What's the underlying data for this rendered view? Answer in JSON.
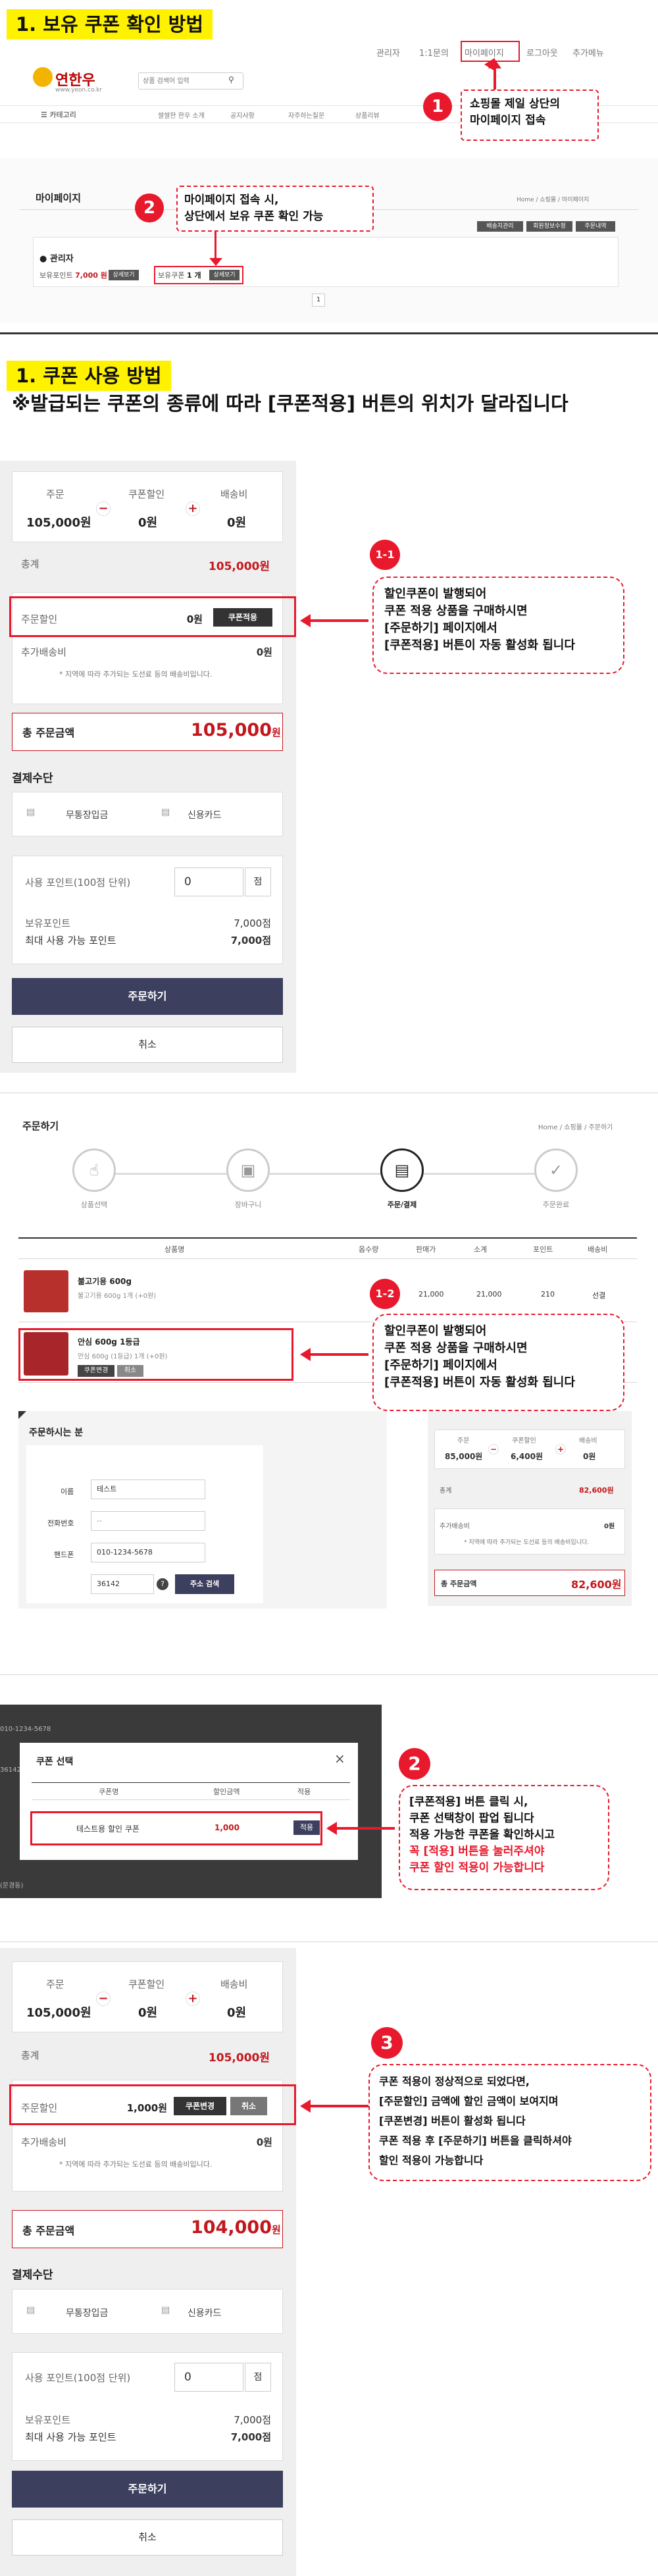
{
  "sec1": {
    "title": "1. 보유 쿠폰 확인 방법"
  },
  "topnav": [
    "관리자",
    "1:1문의",
    "마이페이지",
    "로그아웃",
    "추가메뉴"
  ],
  "logo": {
    "text": "연한우",
    "domain": "www.yeon.co.kr"
  },
  "search": {
    "placeholder": "상품 검색어 입력"
  },
  "menu": {
    "category": "카테고리",
    "items": [
      "쌀쌀한 한우 소개",
      "공지사항",
      "자주하는질문",
      "상품리뷰"
    ]
  },
  "ann1": {
    "num": "1",
    "text": "쇼핑몰 제일 상단의\n마이페이지 접속"
  },
  "mypage": {
    "title": "마이페이지",
    "breadcrumb": "Home / 쇼핑몰 / 마이페이지",
    "tabs": [
      "배송지관리",
      "회원정보수정",
      "주문내역"
    ],
    "user": "관리자",
    "points_label": "보유포인트",
    "points": "7,000 원",
    "points_btn": "상세보기",
    "coupon_label": "보유쿠폰",
    "coupon_count": "1 개",
    "coupon_btn": "상세보기",
    "page": "1"
  },
  "ann2a": {
    "num": "2",
    "text": "마이페이지 접속 시,\n상단에서 보유 쿠폰 확인 가능"
  },
  "sec2": {
    "title": "1. 쿠폰 사용 방법",
    "subtitle": "※발급되는 쿠폰의 종류에 따라 [쿠폰적용] 버튼의 위치가 달라집니다"
  },
  "order1": {
    "h1": "주문",
    "h2": "쿠폰할인",
    "h3": "배송비",
    "v1": "105,000원",
    "v2": "0원",
    "v3": "0원",
    "total_label": "총계",
    "total": "105,000원",
    "coupon_label": "주문할인",
    "coupon_val": "0원",
    "coupon_btn": "쿠폰적용",
    "extra_label": "추가배송비",
    "extra_val": "0원",
    "note": "* 지역에 따라 추가되는 도선료 등의 배송비입니다.",
    "sum_label": "총 주문금액",
    "sum_val": "105,000",
    "sum_unit": "원",
    "pay_title": "결제수단",
    "pay1": "무통장입금",
    "pay2": "신용카드",
    "point_label": "사용 포인트(100점 단위)",
    "point_val": "0",
    "point_unit": "점",
    "have_label": "보유포인트",
    "have_val": "7,000점",
    "max_label": "최대 사용 가능 포인트",
    "max_val": "7,000점",
    "order_btn": "주문하기",
    "cancel_btn": "취소"
  },
  "ann11": {
    "num": "1-1",
    "text": "할인쿠폰이 발행되어\n쿠폰 적용 상품을 구매하시면\n[주문하기] 페이지에서\n[쿠폰적용] 버튼이 자동 활성화 됩니다"
  },
  "order2": {
    "title": "주문하기",
    "breadcrumb": "Home / 쇼핑몰 / 주문하기",
    "steps": [
      "상품선택",
      "장바구니",
      "주문/결제",
      "주문완료"
    ],
    "cols": [
      "상품명",
      "옵수량",
      "판매가",
      "소계",
      "포인트",
      "배송비"
    ],
    "p1_name": "불고기용 600g",
    "p1_opt": "불고기용 600g 1개 (+0원)",
    "p1_price": "21,000",
    "p1_sub": "21,000",
    "p1_pt": "210",
    "p1_ship": "선결",
    "p2_name": "안심 600g 1등급",
    "p2_opt": "안심 600g (1등급) 1개 (+0원)",
    "p2_btn1": "쿠폰변경",
    "p2_btn2": "취소",
    "orderer_title": "주문하시는 분",
    "f_name": "이름",
    "f_name_val": "테스트",
    "f_tel": "전화번호",
    "f_tel_val": "--",
    "f_hp": "핸드폰",
    "f_hp_val": "010-1234-5678",
    "f_zip_val": "36142",
    "f_zip_btn": "주소 검색",
    "s_h1": "주문",
    "s_h2": "쿠폰할인",
    "s_h3": "배송비",
    "s_v1": "85,000원",
    "s_v2": "6,400원",
    "s_v3": "0원",
    "s_total_label": "총계",
    "s_total": "82,600원",
    "s_extra_label": "추가배송비",
    "s_extra_val": "0원",
    "s_note": "* 지역에 따라 추가되는 도선료 등의 배송비입니다.",
    "s_sum_label": "총 주문금액",
    "s_sum_val": "82,600원"
  },
  "ann12": {
    "num": "1-2",
    "text": "할인쿠폰이 발행되어\n쿠폰 적용 상품을 구매하시면\n[주문하기] 페이지에서\n[쿠폰적용] 버튼이 자동 활성화 됩니다"
  },
  "modal": {
    "title": "쿠폰 선택",
    "cols": [
      "쿠폰명",
      "할인금액",
      "적용"
    ],
    "row_name": "테스트용 할인 쿠폰",
    "row_amt": "1,000",
    "row_btn": "적용",
    "bg": [
      "010-1234-5678",
      "36142",
      "(문경동)"
    ]
  },
  "ann2b": {
    "num": "2",
    "text": "[쿠폰적용] 버튼 클릭 시,\n쿠폰 선택창이 팝업 됩니다\n적용 가능한 쿠폰을 확인하시고",
    "red": "꼭 [적용] 버튼을 눌러주셔야\n쿠폰 할인 적용이 가능합니다"
  },
  "order3": {
    "h1": "주문",
    "h2": "쿠폰할인",
    "h3": "배송비",
    "v1": "105,000원",
    "v2": "0원",
    "v3": "0원",
    "total_label": "총계",
    "total": "105,000원",
    "coupon_label": "주문할인",
    "coupon_val": "1,000원",
    "coupon_btn1": "쿠폰변경",
    "coupon_btn2": "취소",
    "extra_label": "추가배송비",
    "extra_val": "0원",
    "note": "* 지역에 따라 추가되는 도선료 등의 배송비입니다.",
    "sum_label": "총 주문금액",
    "sum_val": "104,000",
    "sum_unit": "원",
    "pay_title": "결제수단",
    "pay1": "무통장입금",
    "pay2": "신용카드",
    "point_label": "사용 포인트(100점 단위)",
    "point_val": "0",
    "point_unit": "점",
    "have_label": "보유포인트",
    "have_val": "7,000점",
    "max_label": "최대 사용 가능 포인트",
    "max_val": "7,000점",
    "order_btn": "주문하기",
    "cancel_btn": "취소"
  },
  "ann3": {
    "num": "3",
    "text": "쿠폰 적용이 정상적으로 되었다면,\n[주문할인] 금액에 할인 금액이 보여지며\n[쿠폰변경] 버튼이 활성화 됩니다\n쿠폰 적용 후 [주문하기] 버튼을 클릭하셔야\n할인 적용이 가능합니다"
  },
  "colors": {
    "accent_red": "#e8192c",
    "highlight_yellow": "#fff200",
    "button_navy": "#3c3f5e",
    "price_red": "#c3171d"
  }
}
